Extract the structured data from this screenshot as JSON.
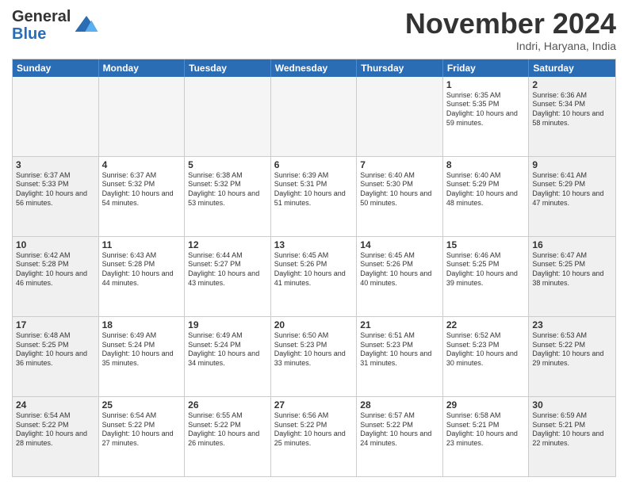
{
  "header": {
    "logo_general": "General",
    "logo_blue": "Blue",
    "month_title": "November 2024",
    "subtitle": "Indri, Haryana, India"
  },
  "weekdays": [
    "Sunday",
    "Monday",
    "Tuesday",
    "Wednesday",
    "Thursday",
    "Friday",
    "Saturday"
  ],
  "weeks": [
    [
      {
        "day": "",
        "empty": true
      },
      {
        "day": "",
        "empty": true
      },
      {
        "day": "",
        "empty": true
      },
      {
        "day": "",
        "empty": true
      },
      {
        "day": "",
        "empty": true
      },
      {
        "day": "1",
        "info": "Sunrise: 6:35 AM\nSunset: 5:35 PM\nDaylight: 10 hours and 59 minutes."
      },
      {
        "day": "2",
        "info": "Sunrise: 6:36 AM\nSunset: 5:34 PM\nDaylight: 10 hours and 58 minutes."
      }
    ],
    [
      {
        "day": "3",
        "info": "Sunrise: 6:37 AM\nSunset: 5:33 PM\nDaylight: 10 hours and 56 minutes."
      },
      {
        "day": "4",
        "info": "Sunrise: 6:37 AM\nSunset: 5:32 PM\nDaylight: 10 hours and 54 minutes."
      },
      {
        "day": "5",
        "info": "Sunrise: 6:38 AM\nSunset: 5:32 PM\nDaylight: 10 hours and 53 minutes."
      },
      {
        "day": "6",
        "info": "Sunrise: 6:39 AM\nSunset: 5:31 PM\nDaylight: 10 hours and 51 minutes."
      },
      {
        "day": "7",
        "info": "Sunrise: 6:40 AM\nSunset: 5:30 PM\nDaylight: 10 hours and 50 minutes."
      },
      {
        "day": "8",
        "info": "Sunrise: 6:40 AM\nSunset: 5:29 PM\nDaylight: 10 hours and 48 minutes."
      },
      {
        "day": "9",
        "info": "Sunrise: 6:41 AM\nSunset: 5:29 PM\nDaylight: 10 hours and 47 minutes."
      }
    ],
    [
      {
        "day": "10",
        "info": "Sunrise: 6:42 AM\nSunset: 5:28 PM\nDaylight: 10 hours and 46 minutes."
      },
      {
        "day": "11",
        "info": "Sunrise: 6:43 AM\nSunset: 5:28 PM\nDaylight: 10 hours and 44 minutes."
      },
      {
        "day": "12",
        "info": "Sunrise: 6:44 AM\nSunset: 5:27 PM\nDaylight: 10 hours and 43 minutes."
      },
      {
        "day": "13",
        "info": "Sunrise: 6:45 AM\nSunset: 5:26 PM\nDaylight: 10 hours and 41 minutes."
      },
      {
        "day": "14",
        "info": "Sunrise: 6:45 AM\nSunset: 5:26 PM\nDaylight: 10 hours and 40 minutes."
      },
      {
        "day": "15",
        "info": "Sunrise: 6:46 AM\nSunset: 5:25 PM\nDaylight: 10 hours and 39 minutes."
      },
      {
        "day": "16",
        "info": "Sunrise: 6:47 AM\nSunset: 5:25 PM\nDaylight: 10 hours and 38 minutes."
      }
    ],
    [
      {
        "day": "17",
        "info": "Sunrise: 6:48 AM\nSunset: 5:25 PM\nDaylight: 10 hours and 36 minutes."
      },
      {
        "day": "18",
        "info": "Sunrise: 6:49 AM\nSunset: 5:24 PM\nDaylight: 10 hours and 35 minutes."
      },
      {
        "day": "19",
        "info": "Sunrise: 6:49 AM\nSunset: 5:24 PM\nDaylight: 10 hours and 34 minutes."
      },
      {
        "day": "20",
        "info": "Sunrise: 6:50 AM\nSunset: 5:23 PM\nDaylight: 10 hours and 33 minutes."
      },
      {
        "day": "21",
        "info": "Sunrise: 6:51 AM\nSunset: 5:23 PM\nDaylight: 10 hours and 31 minutes."
      },
      {
        "day": "22",
        "info": "Sunrise: 6:52 AM\nSunset: 5:23 PM\nDaylight: 10 hours and 30 minutes."
      },
      {
        "day": "23",
        "info": "Sunrise: 6:53 AM\nSunset: 5:22 PM\nDaylight: 10 hours and 29 minutes."
      }
    ],
    [
      {
        "day": "24",
        "info": "Sunrise: 6:54 AM\nSunset: 5:22 PM\nDaylight: 10 hours and 28 minutes."
      },
      {
        "day": "25",
        "info": "Sunrise: 6:54 AM\nSunset: 5:22 PM\nDaylight: 10 hours and 27 minutes."
      },
      {
        "day": "26",
        "info": "Sunrise: 6:55 AM\nSunset: 5:22 PM\nDaylight: 10 hours and 26 minutes."
      },
      {
        "day": "27",
        "info": "Sunrise: 6:56 AM\nSunset: 5:22 PM\nDaylight: 10 hours and 25 minutes."
      },
      {
        "day": "28",
        "info": "Sunrise: 6:57 AM\nSunset: 5:22 PM\nDaylight: 10 hours and 24 minutes."
      },
      {
        "day": "29",
        "info": "Sunrise: 6:58 AM\nSunset: 5:21 PM\nDaylight: 10 hours and 23 minutes."
      },
      {
        "day": "30",
        "info": "Sunrise: 6:59 AM\nSunset: 5:21 PM\nDaylight: 10 hours and 22 minutes."
      }
    ]
  ]
}
